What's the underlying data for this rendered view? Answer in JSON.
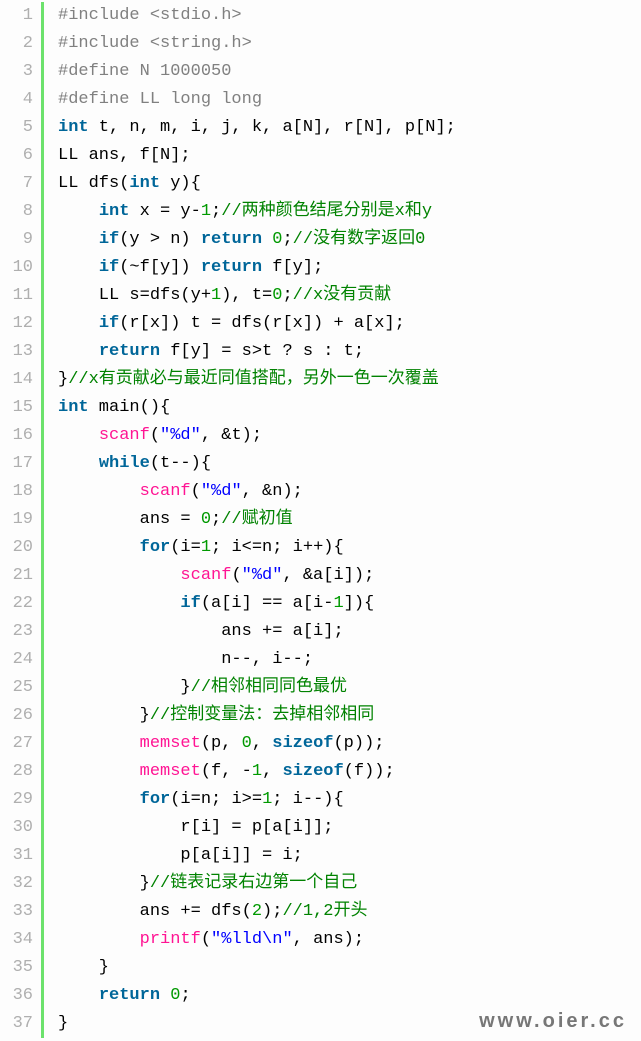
{
  "watermark": "www.oier.cc",
  "lines": [
    {
      "n": "1",
      "tokens": [
        {
          "c": "pp",
          "t": "#include <stdio.h>"
        }
      ]
    },
    {
      "n": "2",
      "tokens": [
        {
          "c": "pp",
          "t": "#include <string.h>"
        }
      ]
    },
    {
      "n": "3",
      "tokens": [
        {
          "c": "pp",
          "t": "#define N 1000050"
        }
      ]
    },
    {
      "n": "4",
      "tokens": [
        {
          "c": "pp",
          "t": "#define LL long long"
        }
      ]
    },
    {
      "n": "5",
      "tokens": [
        {
          "c": "kw",
          "t": "int"
        },
        {
          "t": " t, n, m, i, j, k, a[N], r[N], p[N];"
        }
      ]
    },
    {
      "n": "6",
      "tokens": [
        {
          "t": "LL ans, f[N];"
        }
      ]
    },
    {
      "n": "7",
      "tokens": [
        {
          "t": "LL dfs("
        },
        {
          "c": "kw",
          "t": "int"
        },
        {
          "t": " y){"
        }
      ]
    },
    {
      "n": "8",
      "tokens": [
        {
          "t": "    "
        },
        {
          "c": "kw",
          "t": "int"
        },
        {
          "t": " x = y-"
        },
        {
          "c": "num",
          "t": "1"
        },
        {
          "t": ";"
        },
        {
          "c": "cmt",
          "t": "//两种颜色结尾分别是x和y"
        }
      ]
    },
    {
      "n": "9",
      "tokens": [
        {
          "t": "    "
        },
        {
          "c": "kw",
          "t": "if"
        },
        {
          "t": "(y > n) "
        },
        {
          "c": "kw",
          "t": "return"
        },
        {
          "t": " "
        },
        {
          "c": "num",
          "t": "0"
        },
        {
          "t": ";"
        },
        {
          "c": "cmt",
          "t": "//没有数字返回0"
        }
      ]
    },
    {
      "n": "10",
      "tokens": [
        {
          "t": "    "
        },
        {
          "c": "kw",
          "t": "if"
        },
        {
          "t": "(~f[y]) "
        },
        {
          "c": "kw",
          "t": "return"
        },
        {
          "t": " f[y];"
        }
      ]
    },
    {
      "n": "11",
      "tokens": [
        {
          "t": "    LL s=dfs(y+"
        },
        {
          "c": "num",
          "t": "1"
        },
        {
          "t": "), t="
        },
        {
          "c": "num",
          "t": "0"
        },
        {
          "t": ";"
        },
        {
          "c": "cmt",
          "t": "//x没有贡献"
        }
      ]
    },
    {
      "n": "12",
      "tokens": [
        {
          "t": "    "
        },
        {
          "c": "kw",
          "t": "if"
        },
        {
          "t": "(r[x]) t = dfs(r[x]) + a[x];"
        }
      ]
    },
    {
      "n": "13",
      "tokens": [
        {
          "t": "    "
        },
        {
          "c": "kw",
          "t": "return"
        },
        {
          "t": " f[y] = s>t ? s : t;"
        }
      ]
    },
    {
      "n": "14",
      "tokens": [
        {
          "t": "}"
        },
        {
          "c": "cmt",
          "t": "//x有贡献必与最近同值搭配，另外一色一次覆盖"
        }
      ]
    },
    {
      "n": "15",
      "tokens": [
        {
          "c": "kw",
          "t": "int"
        },
        {
          "t": " main(){"
        }
      ]
    },
    {
      "n": "16",
      "tokens": [
        {
          "t": "    "
        },
        {
          "c": "fn",
          "t": "scanf"
        },
        {
          "t": "("
        },
        {
          "c": "str",
          "t": "\"%d\""
        },
        {
          "t": ", &t);"
        }
      ]
    },
    {
      "n": "17",
      "tokens": [
        {
          "t": "    "
        },
        {
          "c": "kw",
          "t": "while"
        },
        {
          "t": "(t--){"
        }
      ]
    },
    {
      "n": "18",
      "tokens": [
        {
          "t": "        "
        },
        {
          "c": "fn",
          "t": "scanf"
        },
        {
          "t": "("
        },
        {
          "c": "str",
          "t": "\"%d\""
        },
        {
          "t": ", &n);"
        }
      ]
    },
    {
      "n": "19",
      "tokens": [
        {
          "t": "        ans = "
        },
        {
          "c": "num",
          "t": "0"
        },
        {
          "t": ";"
        },
        {
          "c": "cmt",
          "t": "//赋初值"
        }
      ]
    },
    {
      "n": "20",
      "tokens": [
        {
          "t": "        "
        },
        {
          "c": "kw",
          "t": "for"
        },
        {
          "t": "(i="
        },
        {
          "c": "num",
          "t": "1"
        },
        {
          "t": "; i<=n; i++){"
        }
      ]
    },
    {
      "n": "21",
      "tokens": [
        {
          "t": "            "
        },
        {
          "c": "fn",
          "t": "scanf"
        },
        {
          "t": "("
        },
        {
          "c": "str",
          "t": "\"%d\""
        },
        {
          "t": ", &a[i]);"
        }
      ]
    },
    {
      "n": "22",
      "tokens": [
        {
          "t": "            "
        },
        {
          "c": "kw",
          "t": "if"
        },
        {
          "t": "(a[i] == a[i-"
        },
        {
          "c": "num",
          "t": "1"
        },
        {
          "t": "]){"
        }
      ]
    },
    {
      "n": "23",
      "tokens": [
        {
          "t": "                ans += a[i];"
        }
      ]
    },
    {
      "n": "24",
      "tokens": [
        {
          "t": "                n--, i--;"
        }
      ]
    },
    {
      "n": "25",
      "tokens": [
        {
          "t": "            }"
        },
        {
          "c": "cmt",
          "t": "//相邻相同同色最优"
        }
      ]
    },
    {
      "n": "26",
      "tokens": [
        {
          "t": "        }"
        },
        {
          "c": "cmt",
          "t": "//控制变量法：去掉相邻相同"
        }
      ]
    },
    {
      "n": "27",
      "tokens": [
        {
          "t": "        "
        },
        {
          "c": "fn",
          "t": "memset"
        },
        {
          "t": "(p, "
        },
        {
          "c": "num",
          "t": "0"
        },
        {
          "t": ", "
        },
        {
          "c": "kw",
          "t": "sizeof"
        },
        {
          "t": "(p));"
        }
      ]
    },
    {
      "n": "28",
      "tokens": [
        {
          "t": "        "
        },
        {
          "c": "fn",
          "t": "memset"
        },
        {
          "t": "(f, -"
        },
        {
          "c": "num",
          "t": "1"
        },
        {
          "t": ", "
        },
        {
          "c": "kw",
          "t": "sizeof"
        },
        {
          "t": "(f));"
        }
      ]
    },
    {
      "n": "29",
      "tokens": [
        {
          "t": "        "
        },
        {
          "c": "kw",
          "t": "for"
        },
        {
          "t": "(i=n; i>="
        },
        {
          "c": "num",
          "t": "1"
        },
        {
          "t": "; i--){"
        }
      ]
    },
    {
      "n": "30",
      "tokens": [
        {
          "t": "            r[i] = p[a[i]];"
        }
      ]
    },
    {
      "n": "31",
      "tokens": [
        {
          "t": "            p[a[i]] = i;"
        }
      ]
    },
    {
      "n": "32",
      "tokens": [
        {
          "t": "        }"
        },
        {
          "c": "cmt",
          "t": "//链表记录右边第一个自己"
        }
      ]
    },
    {
      "n": "33",
      "tokens": [
        {
          "t": "        ans += dfs("
        },
        {
          "c": "num",
          "t": "2"
        },
        {
          "t": ");"
        },
        {
          "c": "cmt",
          "t": "//1,2开头"
        }
      ]
    },
    {
      "n": "34",
      "tokens": [
        {
          "t": "        "
        },
        {
          "c": "fn",
          "t": "printf"
        },
        {
          "t": "("
        },
        {
          "c": "str",
          "t": "\"%lld\\n\""
        },
        {
          "t": ", ans);"
        }
      ]
    },
    {
      "n": "35",
      "tokens": [
        {
          "t": "    }"
        }
      ]
    },
    {
      "n": "36",
      "tokens": [
        {
          "t": "    "
        },
        {
          "c": "kw",
          "t": "return"
        },
        {
          "t": " "
        },
        {
          "c": "num",
          "t": "0"
        },
        {
          "t": ";"
        }
      ]
    },
    {
      "n": "37",
      "tokens": [
        {
          "t": "}"
        }
      ]
    }
  ]
}
